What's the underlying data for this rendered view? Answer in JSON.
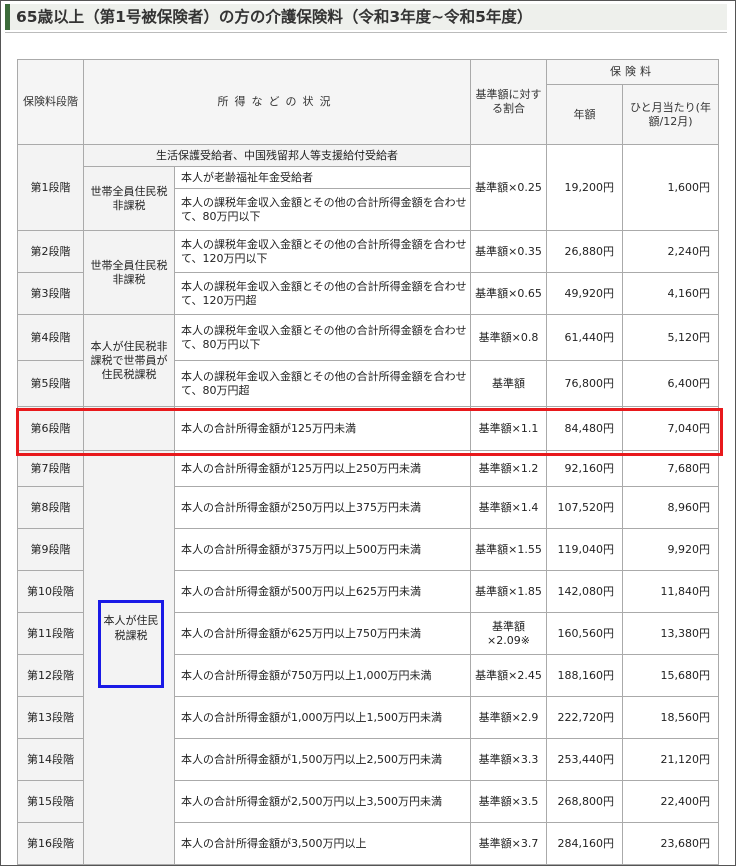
{
  "title": "65歳以上（第1号被保険者）の方の介護保険料（令和3年度~令和5年度）",
  "headers": {
    "stage": "保険料段階",
    "status": "所得などの状況",
    "ratio": "基準額に対する割合",
    "premium": "保険料",
    "annual": "年額",
    "monthly": "ひと月当たり(年額/12月)"
  },
  "groups": {
    "welfare": "生活保護受給者、中国残留邦人等支援給付受給者",
    "household_exempt_1": "世帯全員住民税非課税",
    "household_exempt_2": "世帯全員住民税非課税",
    "self_exempt": "本人が住民税非課税で世帯員が住民税課税",
    "self_taxed": "本人が住民税課税"
  },
  "rows": [
    {
      "stage": "第1段階",
      "conditions": [
        "本人が老齢福祉年金受給者",
        "本人の課税年金収入金額とその他の合計所得金額を合わせて、80万円以下"
      ],
      "ratio": "基準額×0.25",
      "annual": "19,200円",
      "monthly": "1,600円"
    },
    {
      "stage": "第2段階",
      "condition": "本人の課税年金収入金額とその他の合計所得金額を合わせて、120万円以下",
      "ratio": "基準額×0.35",
      "annual": "26,880円",
      "monthly": "2,240円"
    },
    {
      "stage": "第3段階",
      "condition": "本人の課税年金収入金額とその他の合計所得金額を合わせて、120万円超",
      "ratio": "基準額×0.65",
      "annual": "49,920円",
      "monthly": "4,160円"
    },
    {
      "stage": "第4段階",
      "condition": "本人の課税年金収入金額とその他の合計所得金額を合わせて、80万円以下",
      "ratio": "基準額×0.8",
      "annual": "61,440円",
      "monthly": "5,120円"
    },
    {
      "stage": "第5段階",
      "condition": "本人の課税年金収入金額とその他の合計所得金額を合わせて、80万円超",
      "ratio": "基準額",
      "annual": "76,800円",
      "monthly": "6,400円"
    },
    {
      "stage": "第6段階",
      "condition": "本人の合計所得金額が125万円未満",
      "ratio": "基準額×1.1",
      "annual": "84,480円",
      "monthly": "7,040円"
    },
    {
      "stage": "第7段階",
      "condition": "本人の合計所得金額が125万円以上250万円未満",
      "ratio": "基準額×1.2",
      "annual": "92,160円",
      "monthly": "7,680円"
    },
    {
      "stage": "第8段階",
      "condition": "本人の合計所得金額が250万円以上375万円未満",
      "ratio": "基準額×1.4",
      "annual": "107,520円",
      "monthly": "8,960円"
    },
    {
      "stage": "第9段階",
      "condition": "本人の合計所得金額が375万円以上500万円未満",
      "ratio": "基準額×1.55",
      "annual": "119,040円",
      "monthly": "9,920円"
    },
    {
      "stage": "第10段階",
      "condition": "本人の合計所得金額が500万円以上625万円未満",
      "ratio": "基準額×1.85",
      "annual": "142,080円",
      "monthly": "11,840円"
    },
    {
      "stage": "第11段階",
      "condition": "本人の合計所得金額が625万円以上750万円未満",
      "ratio": "基準額×2.09※",
      "annual": "160,560円",
      "monthly": "13,380円"
    },
    {
      "stage": "第12段階",
      "condition": "本人の合計所得金額が750万円以上1,000万円未満",
      "ratio": "基準額×2.45",
      "annual": "188,160円",
      "monthly": "15,680円"
    },
    {
      "stage": "第13段階",
      "condition": "本人の合計所得金額が1,000万円以上1,500万円未満",
      "ratio": "基準額×2.9",
      "annual": "222,720円",
      "monthly": "18,560円"
    },
    {
      "stage": "第14段階",
      "condition": "本人の合計所得金額が1,500万円以上2,500万円未満",
      "ratio": "基準額×3.3",
      "annual": "253,440円",
      "monthly": "21,120円"
    },
    {
      "stage": "第15段階",
      "condition": "本人の合計所得金額が2,500万円以上3,500万円未満",
      "ratio": "基準額×3.5",
      "annual": "268,800円",
      "monthly": "22,400円"
    },
    {
      "stage": "第16段階",
      "condition": "本人の合計所得金額が3,500万円以上",
      "ratio": "基準額×3.7",
      "annual": "284,160円",
      "monthly": "23,680円"
    }
  ],
  "highlights": {
    "red": "#e8191c",
    "blue": "#1a1ae6"
  }
}
